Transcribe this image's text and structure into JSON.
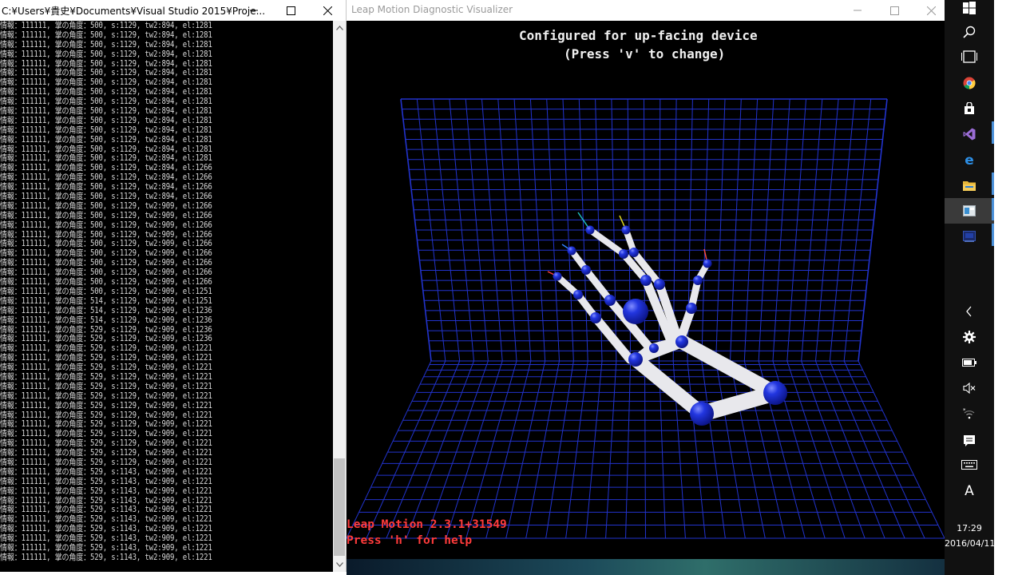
{
  "console": {
    "title": "C:¥Users¥貴史¥Documents¥Visual Studio 2015¥Proje...",
    "lines": [
      "情報：111111, 掌の角度：500, s:1129, tw2:894, el:1281",
      "情報：111111, 掌の角度：500, s:1129, tw2:894, el:1281",
      "情報：111111, 掌の角度：500, s:1129, tw2:894, el:1281",
      "情報：111111, 掌の角度：500, s:1129, tw2:894, el:1281",
      "情報：111111, 掌の角度：500, s:1129, tw2:894, el:1281",
      "情報：111111, 掌の角度：500, s:1129, tw2:894, el:1281",
      "情報：111111, 掌の角度：500, s:1129, tw2:894, el:1281",
      "情報：111111, 掌の角度：500, s:1129, tw2:894, el:1281",
      "情報：111111, 掌の角度：500, s:1129, tw2:894, el:1281",
      "情報：111111, 掌の角度：500, s:1129, tw2:894, el:1281",
      "情報：111111, 掌の角度：500, s:1129, tw2:894, el:1281",
      "情報：111111, 掌の角度：500, s:1129, tw2:894, el:1281",
      "情報：111111, 掌の角度：500, s:1129, tw2:894, el:1281",
      "情報：111111, 掌の角度：500, s:1129, tw2:894, el:1281",
      "情報：111111, 掌の角度：500, s:1129, tw2:894, el:1281",
      "情報：111111, 掌の角度：500, s:1129, tw2:894, el:1266",
      "情報：111111, 掌の角度：500, s:1129, tw2:894, el:1266",
      "情報：111111, 掌の角度：500, s:1129, tw2:894, el:1266",
      "情報：111111, 掌の角度：500, s:1129, tw2:894, el:1266",
      "情報：111111, 掌の角度：500, s:1129, tw2:909, el:1266",
      "情報：111111, 掌の角度：500, s:1129, tw2:909, el:1266",
      "情報：111111, 掌の角度：500, s:1129, tw2:909, el:1266",
      "情報：111111, 掌の角度：500, s:1129, tw2:909, el:1266",
      "情報：111111, 掌の角度：500, s:1129, tw2:909, el:1266",
      "情報：111111, 掌の角度：500, s:1129, tw2:909, el:1266",
      "情報：111111, 掌の角度：500, s:1129, tw2:909, el:1266",
      "情報：111111, 掌の角度：500, s:1129, tw2:909, el:1266",
      "情報：111111, 掌の角度：500, s:1129, tw2:909, el:1266",
      "情報：111111, 掌の角度：500, s:1129, tw2:909, el:1251",
      "情報：111111, 掌の角度：514, s:1129, tw2:909, el:1251",
      "情報：111111, 掌の角度：514, s:1129, tw2:909, el:1236",
      "情報：111111, 掌の角度：514, s:1129, tw2:909, el:1236",
      "情報：111111, 掌の角度：529, s:1129, tw2:909, el:1236",
      "情報：111111, 掌の角度：529, s:1129, tw2:909, el:1236",
      "情報：111111, 掌の角度：529, s:1129, tw2:909, el:1221",
      "情報：111111, 掌の角度：529, s:1129, tw2:909, el:1221",
      "情報：111111, 掌の角度：529, s:1129, tw2:909, el:1221",
      "情報：111111, 掌の角度：529, s:1129, tw2:909, el:1221",
      "情報：111111, 掌の角度：529, s:1129, tw2:909, el:1221",
      "情報：111111, 掌の角度：529, s:1129, tw2:909, el:1221",
      "情報：111111, 掌の角度：529, s:1129, tw2:909, el:1221",
      "情報：111111, 掌の角度：529, s:1129, tw2:909, el:1221",
      "情報：111111, 掌の角度：529, s:1129, tw2:909, el:1221",
      "情報：111111, 掌の角度：529, s:1129, tw2:909, el:1221",
      "情報：111111, 掌の角度：529, s:1129, tw2:909, el:1221",
      "情報：111111, 掌の角度：529, s:1129, tw2:909, el:1221",
      "情報：111111, 掌の角度：529, s:1129, tw2:909, el:1221",
      "情報：111111, 掌の角度：529, s:1143, tw2:909, el:1221",
      "情報：111111, 掌の角度：529, s:1143, tw2:909, el:1221",
      "情報：111111, 掌の角度：529, s:1143, tw2:909, el:1221",
      "情報：111111, 掌の角度：529, s:1143, tw2:909, el:1221",
      "情報：111111, 掌の角度：529, s:1143, tw2:909, el:1221",
      "情報：111111, 掌の角度：529, s:1143, tw2:909, el:1221",
      "情報：111111, 掌の角度：529, s:1143, tw2:909, el:1221",
      "情報：111111, 掌の角度：529, s:1143, tw2:909, el:1221",
      "情報：111111, 掌の角度：529, s:1143, tw2:909, el:1221",
      "情報：111111, 掌の角度：529, s:1143, tw2:909, el:1221"
    ]
  },
  "visualizer": {
    "title": "Leap Motion Diagnostic Visualizer",
    "config_line1": "Configured for up-facing device",
    "config_line2": "(Press 'v' to change)",
    "version": "Leap Motion 2.3.1+31549",
    "help": "Press 'h' for help",
    "grid_color": "#2233cc",
    "bone_color": "#e8e8ec",
    "joint_color": "#1a2bd8"
  },
  "taskbar": {
    "time": "17:29",
    "date": "2016/04/11",
    "ime": "A",
    "icons": [
      "windows-start-icon",
      "search-icon",
      "task-view-icon",
      "chrome-icon",
      "store-icon",
      "visual-studio-icon",
      "edge-icon",
      "file-explorer-icon",
      "visualizer-app-icon",
      "console-app-icon"
    ],
    "tray_icons": [
      "chevron-left-icon",
      "leap-motion-tray-icon",
      "battery-icon",
      "volume-muted-icon",
      "wifi-icon",
      "action-center-icon",
      "keyboard-icon"
    ]
  }
}
